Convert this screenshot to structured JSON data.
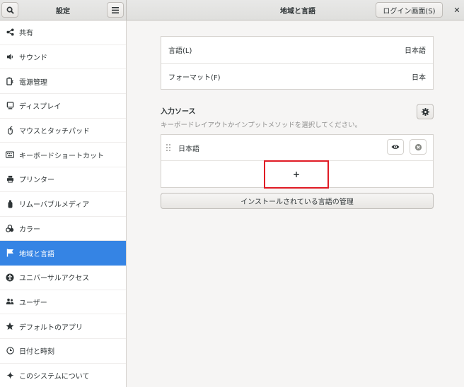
{
  "header": {
    "sidebar_title": "設定",
    "title": "地域と言語",
    "login_button": "ログイン画面(S)",
    "close_glyph": "✕"
  },
  "sidebar": {
    "items": [
      {
        "label": "共有",
        "icon": "share-icon"
      },
      {
        "label": "サウンド",
        "icon": "speaker-icon"
      },
      {
        "label": "電源管理",
        "icon": "battery-icon"
      },
      {
        "label": "ディスプレイ",
        "icon": "display-icon"
      },
      {
        "label": "マウスとタッチパッド",
        "icon": "mouse-icon"
      },
      {
        "label": "キーボードショートカット",
        "icon": "keyboard-icon"
      },
      {
        "label": "プリンター",
        "icon": "printer-icon"
      },
      {
        "label": "リムーバブルメディア",
        "icon": "media-icon"
      },
      {
        "label": "カラー",
        "icon": "color-icon"
      },
      {
        "label": "地域と言語",
        "icon": "flag-icon",
        "selected": true
      },
      {
        "label": "ユニバーサルアクセス",
        "icon": "accessibility-icon"
      },
      {
        "label": "ユーザー",
        "icon": "users-icon"
      },
      {
        "label": "デフォルトのアプリ",
        "icon": "star-icon"
      },
      {
        "label": "日付と時刻",
        "icon": "clock-icon"
      },
      {
        "label": "このシステムについて",
        "icon": "sparkle-icon"
      }
    ]
  },
  "language_card": {
    "language_label": "言語(L)",
    "language_value": "日本語",
    "format_label": "フォーマット(F)",
    "format_value": "日本"
  },
  "input_sources": {
    "title": "入力ソース",
    "subtitle": "キーボードレイアウトかインプットメソッドを選択してください。",
    "items": [
      {
        "label": "日本語"
      }
    ],
    "add_label": "+"
  },
  "manage_button": "インストールされている言語の管理",
  "colors": {
    "accent": "#3584e4",
    "highlight": "#e01b24"
  }
}
